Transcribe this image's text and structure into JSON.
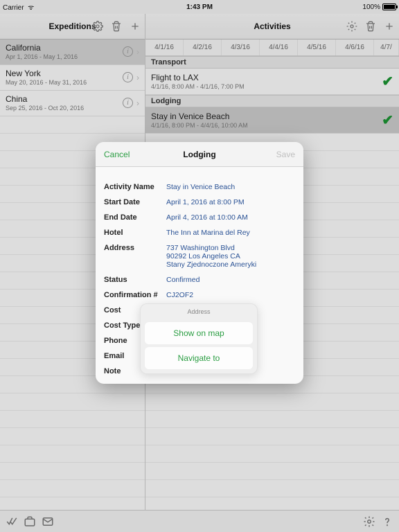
{
  "statusbar": {
    "carrier": "Carrier",
    "wifi": "≈",
    "time": "1:43 PM",
    "battery": "100%"
  },
  "left": {
    "title": "Expeditions",
    "items": [
      {
        "name": "California",
        "dates": "Apr 1, 2016 - May 1, 2016",
        "selected": true
      },
      {
        "name": "New York",
        "dates": "May 20, 2016 - May 31, 2016",
        "selected": false
      },
      {
        "name": "China",
        "dates": "Sep 25, 2016 - Oct 20, 2016",
        "selected": false
      }
    ]
  },
  "right": {
    "title": "Activities",
    "dates": [
      "4/1/16",
      "4/2/16",
      "4/3/16",
      "4/4/16",
      "4/5/16",
      "4/6/16",
      "4/7/"
    ],
    "sections": [
      {
        "header": "Transport",
        "items": [
          {
            "name": "Flight to LAX",
            "dates": "4/1/16, 8:00 AM - 4/1/16, 7:00 PM",
            "done": true,
            "selected": false
          }
        ]
      },
      {
        "header": "Lodging",
        "items": [
          {
            "name": "Stay in Venice Beach",
            "dates": "4/1/16, 8:00 PM - 4/4/16, 10:00 AM",
            "done": true,
            "selected": true
          }
        ]
      }
    ]
  },
  "modal": {
    "title": "Lodging",
    "cancel": "Cancel",
    "save": "Save",
    "fields": {
      "activity_name_label": "Activity Name",
      "activity_name": "Stay in Venice Beach",
      "start_label": "Start Date",
      "start": "April 1, 2016 at 8:00 PM",
      "end_label": "End Date",
      "end": "April 4, 2016 at 10:00 AM",
      "hotel_label": "Hotel",
      "hotel": "The Inn at Marina del Rey",
      "address_label": "Address",
      "address_l1": "737 Washington Blvd",
      "address_l2": "90292 Los Angeles CA",
      "address_l3": "Stany Zjednoczone Ameryki",
      "status_label": "Status",
      "status": "Confirmed",
      "conf_label": "Confirmation #",
      "conf": "CJ2OF2",
      "cost_label": "Cost",
      "cost_type_label": "Cost Type",
      "phone_label": "Phone",
      "email_label": "Email",
      "note_label": "Note"
    }
  },
  "popover": {
    "title": "Address",
    "show": "Show on map",
    "navigate": "Navigate to"
  }
}
